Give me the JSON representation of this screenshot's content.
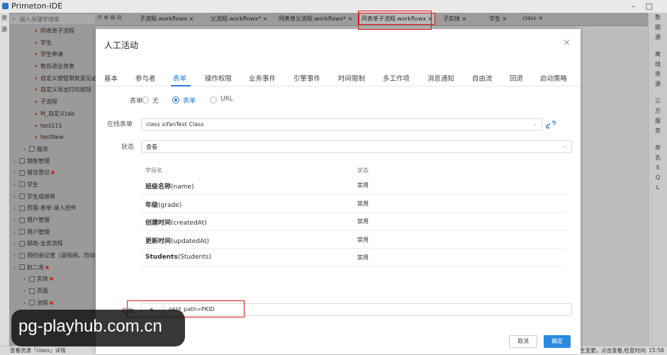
{
  "app": {
    "title": "Primeton-IDE"
  },
  "left_rail": [
    "资",
    "源"
  ],
  "search": {
    "placeholder": "输入关键字搜索"
  },
  "tree": [
    {
      "label": "同表单子流程",
      "kind": "leaf"
    },
    {
      "label": "学生",
      "kind": "leaf"
    },
    {
      "label": "学生申请",
      "kind": "leaf"
    },
    {
      "label": "智存进业务表",
      "kind": "leaf"
    },
    {
      "label": "自定义按钮审批意见必",
      "kind": "leaf"
    },
    {
      "label": "自定义导出打印按钮",
      "kind": "leaf"
    },
    {
      "label": "子流程",
      "kind": "leaf"
    },
    {
      "label": "M_自定义tab",
      "kind": "leaf"
    },
    {
      "label": "test111",
      "kind": "leaf"
    },
    {
      "label": "testNew",
      "kind": "leaf"
    },
    {
      "label": "服务",
      "kind": "folder"
    },
    {
      "label": "销售管理",
      "kind": "group"
    },
    {
      "label": "借访登记",
      "kind": "group",
      "badge": true
    },
    {
      "label": "学生",
      "kind": "group"
    },
    {
      "label": "学生成绩单",
      "kind": "group"
    },
    {
      "label": "页面-表单-录入控件",
      "kind": "group"
    },
    {
      "label": "用户管理",
      "kind": "group"
    },
    {
      "label": "用户管理",
      "kind": "group"
    },
    {
      "label": "邮政-业务流程",
      "kind": "group"
    },
    {
      "label": "预约会议室（录视频，勿动",
      "kind": "group"
    },
    {
      "label": "赵二龙",
      "kind": "group",
      "badge": true
    },
    {
      "label": "实体",
      "kind": "folder",
      "badge": true
    },
    {
      "label": "页面",
      "kind": "folder"
    },
    {
      "label": "流程",
      "kind": "folder",
      "badge": true
    }
  ],
  "tabs": [
    {
      "label": "子流程.workflowx",
      "close": "×"
    },
    {
      "label": "父流程.workflowx*",
      "close": "×"
    },
    {
      "label": "同表单父流程.workflowx*",
      "close": "×"
    },
    {
      "label": "同表单子流程.workflowx",
      "close": "×",
      "active": true
    },
    {
      "label": "子实体",
      "close": "×"
    },
    {
      "label": "学生",
      "close": "×"
    },
    {
      "label": "class",
      "close": "×"
    }
  ],
  "right_rail": [
    "数",
    "据",
    "源",
    "",
    "离",
    "线",
    "资",
    "源",
    "",
    "三",
    "方",
    "服",
    "务",
    "",
    "命",
    "名",
    "S",
    "Q",
    "L"
  ],
  "dialog": {
    "title": "人工活动",
    "tabs": [
      "基本",
      "参与者",
      "表单",
      "操作权限",
      "业务事件",
      "引擎事件",
      "时间限制",
      "多工作项",
      "消息通知",
      "自由流",
      "回退",
      "启动策略"
    ],
    "active_tab": "表单",
    "form_label": "表单:",
    "radio_options": [
      "无",
      "表单",
      "URL"
    ],
    "radio_selected": "表单",
    "online_form_label": "在线表单",
    "online_form_value": "class xifanTest Class",
    "state_label": "状态",
    "state_value": "查看",
    "table_headers": [
      "字段名",
      "状态"
    ],
    "fields": [
      {
        "name": "班级名称",
        "code": "(name)",
        "status": "禁用"
      },
      {
        "name": "年级",
        "code": "(grade)",
        "status": "禁用"
      },
      {
        "name": "创建时间",
        "code": "(createdAt)",
        "status": "禁用"
      },
      {
        "name": "更新时间",
        "code": "(updatedAt)",
        "status": "禁用"
      },
      {
        "name": "Students",
        "code": "(Students)",
        "status": "禁用"
      }
    ],
    "pk_label": "参数",
    "pk_value": "pkId_path=PKID",
    "cancel_label": "取消",
    "ok_label": "确定"
  },
  "statusbar": {
    "left": "查看资源「class」详情",
    "right": "生变更，点击查看,检查时间: 15:56"
  },
  "watermark": {
    "text": "pg-playhub.com.cn"
  },
  "colors": {
    "accent": "#2a7ad9",
    "highlight_box": "#e01414",
    "ok_button": "#2a8be0"
  }
}
